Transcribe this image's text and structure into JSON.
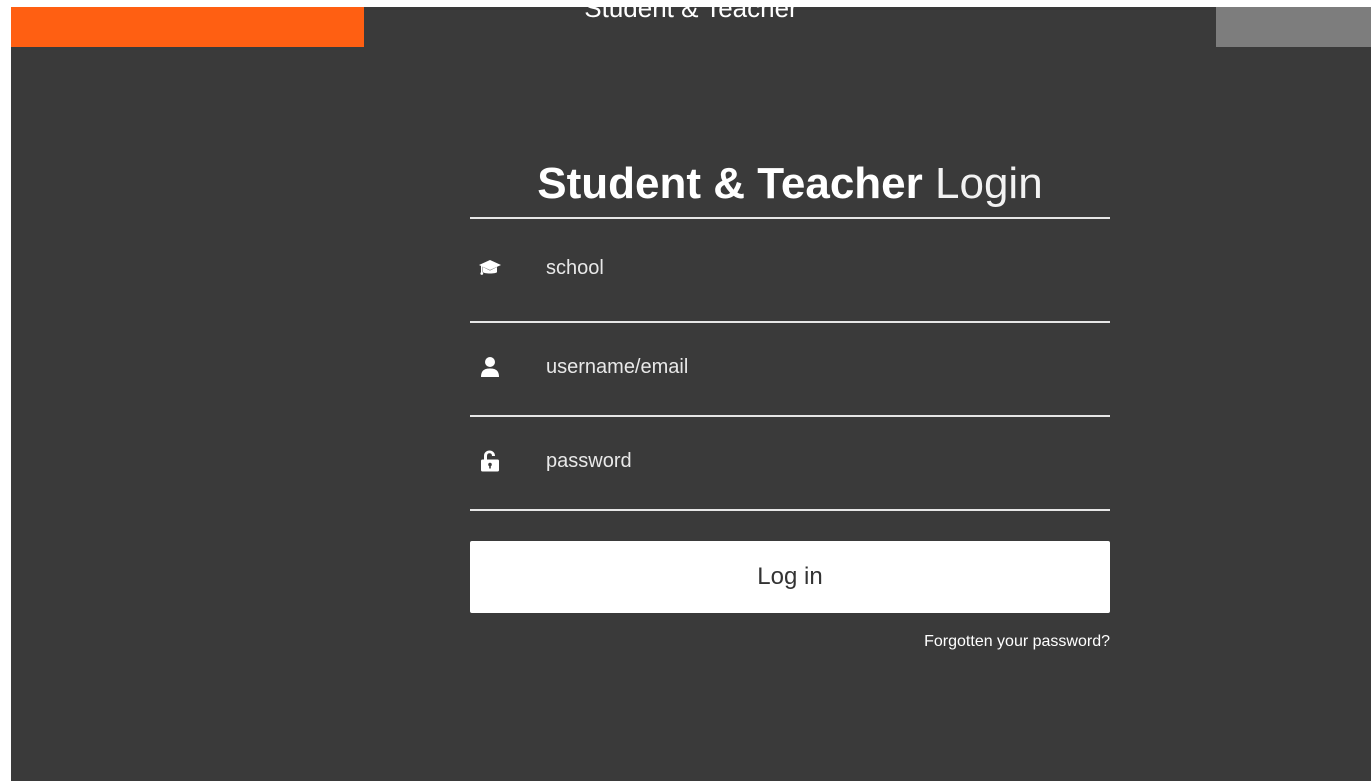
{
  "header": {
    "title": "Student & Teacher"
  },
  "login": {
    "heading_bold": "Student & Teacher",
    "heading_light": "Login",
    "school": {
      "placeholder": "school",
      "value": "",
      "icon": "graduation-cap-icon"
    },
    "username": {
      "placeholder": "username/email",
      "value": "",
      "icon": "user-icon"
    },
    "password": {
      "placeholder": "password",
      "value": "",
      "icon": "unlock-icon"
    },
    "submit_label": "Log in",
    "forgot_label": "Forgotten your password?"
  },
  "colors": {
    "background": "#3a3a3a",
    "accent_orange": "#ff5f12",
    "tab_grey": "#7d7d7d",
    "text": "#ffffff",
    "button_bg": "#ffffff"
  }
}
